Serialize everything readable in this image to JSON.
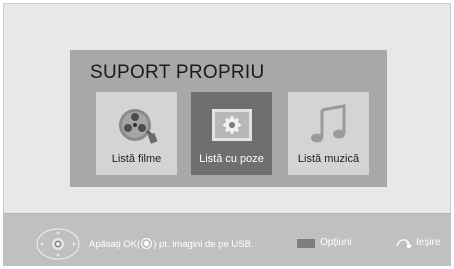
{
  "header": {
    "title": "SUPORT PROPRIU"
  },
  "tiles": [
    {
      "label": "Listă filme",
      "icon": "film-reel-icon",
      "selected": false
    },
    {
      "label": "Listă cu poze",
      "icon": "photo-icon",
      "selected": true
    },
    {
      "label": "Listă muzică",
      "icon": "music-note-icon",
      "selected": false
    }
  ],
  "footer": {
    "hint_prefix": "Apăsaţi OK(",
    "hint_suffix": ") pt. imagini de pe USB.",
    "options_label": "Opţiuni",
    "exit_label": "Ieşire",
    "options_color": "#7e7e7e"
  }
}
